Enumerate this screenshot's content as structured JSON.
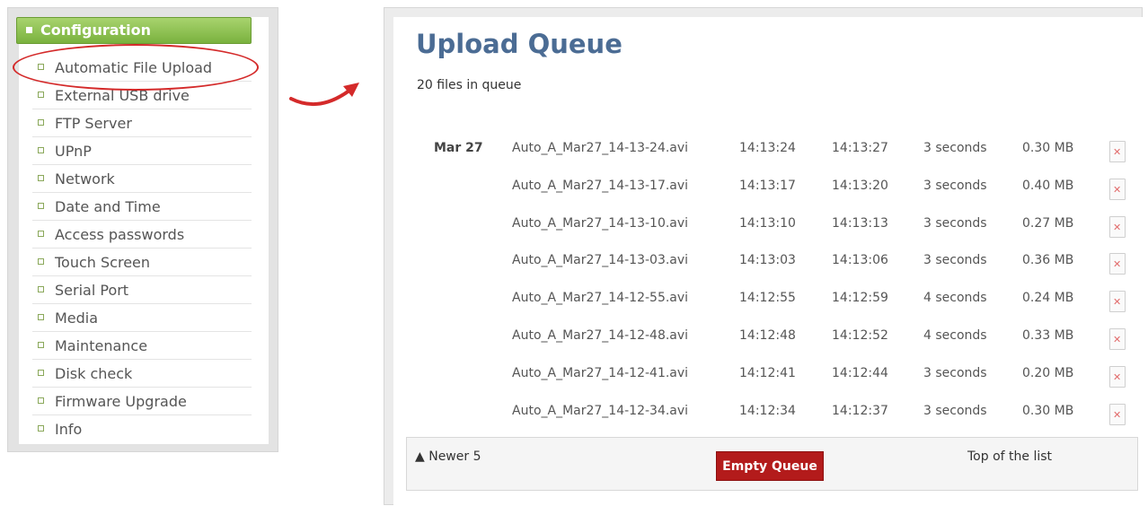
{
  "config_menu": {
    "header": "Configuration",
    "items": [
      "Automatic File Upload",
      "External USB drive",
      "FTP Server",
      "UPnP",
      "Network",
      "Date and Time",
      "Access passwords",
      "Touch Screen",
      "Serial Port",
      "Media",
      "Maintenance",
      "Disk check",
      "Firmware Upgrade",
      "Info"
    ],
    "highlighted_item": "Automatic File Upload"
  },
  "upload_queue": {
    "title": "Upload Queue",
    "count_text": "20 files in queue",
    "rows": [
      {
        "date": "Mar 27",
        "file": "Auto_A_Mar27_14-13-24.avi",
        "start": "14:13:24",
        "end": "14:13:27",
        "duration": "3 seconds",
        "size": "0.30 MB"
      },
      {
        "date": "",
        "file": "Auto_A_Mar27_14-13-17.avi",
        "start": "14:13:17",
        "end": "14:13:20",
        "duration": "3 seconds",
        "size": "0.40 MB"
      },
      {
        "date": "",
        "file": "Auto_A_Mar27_14-13-10.avi",
        "start": "14:13:10",
        "end": "14:13:13",
        "duration": "3 seconds",
        "size": "0.27 MB"
      },
      {
        "date": "",
        "file": "Auto_A_Mar27_14-13-03.avi",
        "start": "14:13:03",
        "end": "14:13:06",
        "duration": "3 seconds",
        "size": "0.36 MB"
      },
      {
        "date": "",
        "file": "Auto_A_Mar27_14-12-55.avi",
        "start": "14:12:55",
        "end": "14:12:59",
        "duration": "4 seconds",
        "size": "0.24 MB"
      },
      {
        "date": "",
        "file": "Auto_A_Mar27_14-12-48.avi",
        "start": "14:12:48",
        "end": "14:12:52",
        "duration": "4 seconds",
        "size": "0.33 MB"
      },
      {
        "date": "",
        "file": "Auto_A_Mar27_14-12-41.avi",
        "start": "14:12:41",
        "end": "14:12:44",
        "duration": "3 seconds",
        "size": "0.20 MB"
      },
      {
        "date": "",
        "file": "Auto_A_Mar27_14-12-34.avi",
        "start": "14:12:34",
        "end": "14:12:37",
        "duration": "3 seconds",
        "size": "0.30 MB"
      }
    ],
    "footer": {
      "newer_label": "▲ Newer 5",
      "empty_button": "Empty Queue",
      "top_label": "Top of the list"
    }
  },
  "colors": {
    "header_green": "#7ab23e",
    "title_blue": "#4b6c94",
    "callout_red": "#d42a2a",
    "empty_button_red": "#b31b1b"
  },
  "icons": {
    "row_action": "delete-file-icon",
    "annotation": "curved-arrow-icon"
  }
}
